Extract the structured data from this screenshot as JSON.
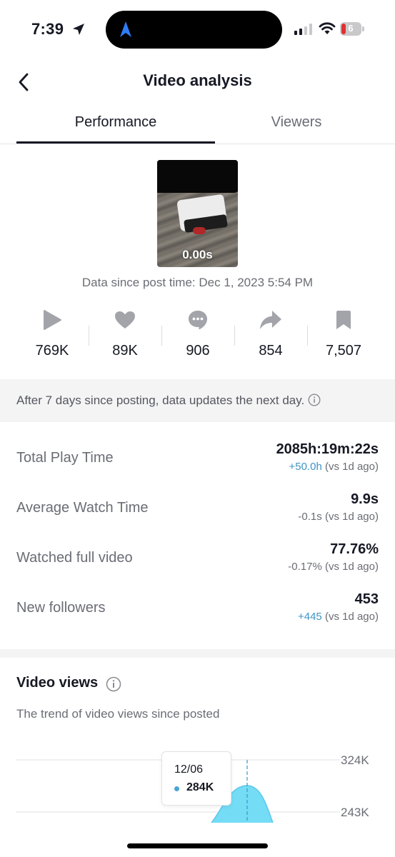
{
  "status_bar": {
    "time": "7:39",
    "battery": "6"
  },
  "header": {
    "title": "Video analysis"
  },
  "tabs": [
    {
      "label": "Performance",
      "active": true
    },
    {
      "label": "Viewers",
      "active": false
    }
  ],
  "video": {
    "thumbnail_time": "0.00s",
    "data_since": "Data since post time: Dec 1, 2023 5:54 PM"
  },
  "stats": [
    {
      "icon": "play-icon",
      "value": "769K"
    },
    {
      "icon": "heart-icon",
      "value": "89K"
    },
    {
      "icon": "comment-icon",
      "value": "906"
    },
    {
      "icon": "share-icon",
      "value": "854"
    },
    {
      "icon": "bookmark-icon",
      "value": "7,507"
    }
  ],
  "notice": "After 7 days since posting, data updates the next day.",
  "metrics": [
    {
      "label": "Total Play Time",
      "value": "2085h:19m:22s",
      "delta": "+50.0h",
      "suffix": "(vs 1d ago)",
      "positive": true
    },
    {
      "label": "Average Watch Time",
      "value": "9.9s",
      "delta": "-0.1s",
      "suffix": "(vs 1d ago)",
      "positive": false
    },
    {
      "label": "Watched full video",
      "value": "77.76%",
      "delta": "-0.17%",
      "suffix": "(vs 1d ago)",
      "positive": false
    },
    {
      "label": "New followers",
      "value": "453",
      "delta": "+445",
      "suffix": "(vs 1d ago)",
      "positive": true
    }
  ],
  "video_views": {
    "title": "Video views",
    "subtitle": "The trend of video views since posted",
    "y_ticks": [
      "324K",
      "243K"
    ],
    "tooltip": {
      "date": "12/06",
      "value": "284K"
    }
  },
  "colors": {
    "accent_blue": "#3e94c6",
    "chart_fill": "#74dcf5",
    "text_primary": "#161823",
    "text_secondary": "#6b6d75"
  }
}
